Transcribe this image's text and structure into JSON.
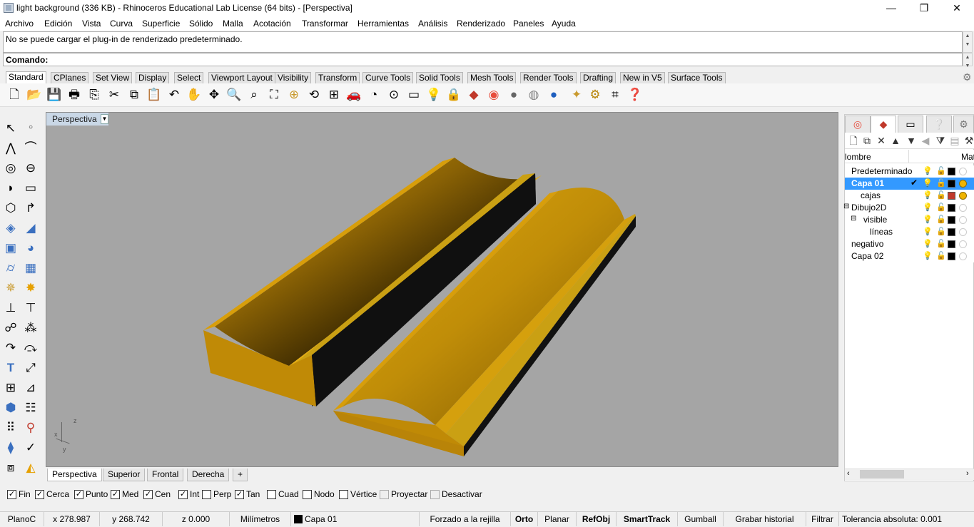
{
  "window": {
    "title": "light background (336 KB) - Rhinoceros Educational Lab License (64 bits) - [Perspectiva]",
    "minimize": "—",
    "maximize": "❐",
    "close": "✕"
  },
  "menu": [
    "Archivo",
    "Edición",
    "Vista",
    "Curva",
    "Superficie",
    "Sólido",
    "Malla",
    "Acotación",
    "Transformar",
    "Herramientas",
    "Análisis",
    "Renderizado",
    "Paneles",
    "Ayuda"
  ],
  "command": {
    "history": "No se puede cargar el plug-in de renderizado predeterminado.",
    "prompt": "Comando:"
  },
  "toolbar_tabs": [
    "Standard",
    "CPlanes",
    "Set View",
    "Display",
    "Select",
    "Viewport Layout",
    "Visibility",
    "Transform",
    "Curve Tools",
    "Solid Tools",
    "Mesh Tools",
    "Render Tools",
    "Drafting",
    "New in V5",
    "Surface Tools"
  ],
  "toolbar_icons": [
    "new-icon",
    "open-icon",
    "save-icon",
    "print-icon",
    "import-icon",
    "cut-icon",
    "copy-icon",
    "paste-icon",
    "undo-icon",
    "pan-icon",
    "rotate-icon",
    "zoom-icon",
    "zoom-window-icon",
    "zoom-extents-icon",
    "zoom-selected-icon",
    "rotate-view-icon",
    "four-viewports-icon",
    "car-icon",
    "render-preview-icon",
    "snap-icon",
    "bulb-icon",
    "lock-icon",
    "layer-icon",
    "color-wheel-icon",
    "sphere-gray-icon",
    "sphere-shaded-icon",
    "sphere-blue-icon",
    "light-icon",
    "settings-icon",
    "grips-icon",
    "help-icon"
  ],
  "viewport": {
    "name": "Perspectiva",
    "dropdown": "▼",
    "axis": {
      "x": "x",
      "y": "y",
      "z": "z"
    }
  },
  "viewport_tabs": [
    "Perspectiva",
    "Superior",
    "Frontal",
    "Derecha",
    "+"
  ],
  "panel": {
    "tabs": [
      "color-icon",
      "layers-icon",
      "display-icon",
      "help-icon",
      "gear-icon"
    ],
    "column_name": "lombre",
    "column_mat": "Mat",
    "layers": [
      {
        "name": "Predeterminado",
        "indent": 0,
        "selected": false,
        "check": "",
        "color": "#000000",
        "material": false
      },
      {
        "name": "Capa 01",
        "indent": 0,
        "selected": true,
        "check": "✔",
        "color": "#000000",
        "material": true
      },
      {
        "name": "cajas",
        "indent": 1,
        "selected": false,
        "check": "",
        "color": "#c0392b",
        "material": true
      },
      {
        "name": "Dibujo2D",
        "indent": 0,
        "selected": false,
        "check": "",
        "color": "#000000",
        "material": false
      },
      {
        "name": "visible",
        "indent": 1,
        "selected": false,
        "check": "",
        "color": "#000000",
        "material": false
      },
      {
        "name": "líneas",
        "indent": 2,
        "selected": false,
        "check": "",
        "color": "#000000",
        "material": false
      },
      {
        "name": "negativo",
        "indent": 0,
        "selected": false,
        "check": "",
        "color": "#000000",
        "material": false
      },
      {
        "name": "Capa 02",
        "indent": 0,
        "selected": false,
        "check": "",
        "color": "#000000",
        "material": false
      }
    ]
  },
  "osnaps": [
    {
      "label": "Fin",
      "checked": true
    },
    {
      "label": "Cerca",
      "checked": true
    },
    {
      "label": "Punto",
      "checked": true
    },
    {
      "label": "Med",
      "checked": true
    },
    {
      "label": "Cen",
      "checked": true
    },
    {
      "label": "Int",
      "checked": true
    },
    {
      "label": "Perp",
      "checked": false
    },
    {
      "label": "Tan",
      "checked": true
    },
    {
      "label": "Cuad",
      "checked": false
    },
    {
      "label": "Nodo",
      "checked": false
    },
    {
      "label": "Vértice",
      "checked": false
    },
    {
      "label": "Proyectar",
      "checked": false,
      "disabled": true
    },
    {
      "label": "Desactivar",
      "checked": false,
      "disabled": true
    }
  ],
  "status": {
    "cplane": "PlanoC",
    "x": "x 278.987",
    "y": "y 268.742",
    "z": "z 0.000",
    "units": "Milímetros",
    "layer": "Capa 01",
    "grid": "Forzado a la rejilla",
    "ortho": "Orto",
    "planar": "Planar",
    "osnap": "RefObj",
    "smarttrack": "SmartTrack",
    "gumball": "Gumball",
    "history": "Grabar historial",
    "filter": "Filtrar",
    "tolerance": "Tolerancia absoluta: 0.001"
  },
  "colors": {
    "model_gold": "#c8920a",
    "viewport_bg": "#a5a5a5",
    "selection": "#3399ff"
  }
}
